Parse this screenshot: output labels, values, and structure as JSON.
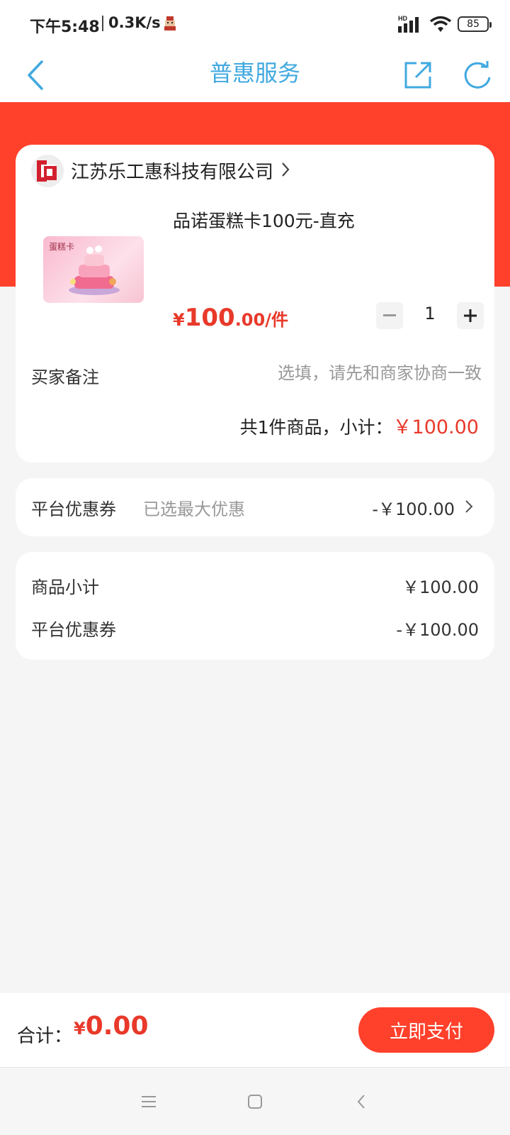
{
  "status_bar": {
    "time": "下午5:48",
    "net_speed": "0.3K/s",
    "signal_label": "HD",
    "battery": "85"
  },
  "nav": {
    "title": "普惠服务"
  },
  "shop": {
    "name": "江苏乐工惠科技有限公司"
  },
  "product": {
    "image_label": "蛋糕卡",
    "title": "品诺蛋糕卡100元-直充",
    "price_currency": "¥",
    "price_int": "100",
    "price_dec": ".00",
    "price_unit": "/件",
    "quantity": "1"
  },
  "note": {
    "label": "买家备注",
    "placeholder": "选填，请先和商家协商一致"
  },
  "order_subtotal": {
    "label": "共1件商品，小计：",
    "amount": "￥100.00"
  },
  "coupon": {
    "label": "平台优惠券",
    "hint": "已选最大优惠",
    "value": "-￥100.00"
  },
  "summary": {
    "rows": [
      {
        "label": "商品小计",
        "value": "￥100.00"
      },
      {
        "label": "平台优惠券",
        "value": "-￥100.00"
      }
    ]
  },
  "checkout": {
    "total_label": "合计：",
    "total_currency": "¥",
    "total_amount": "0.00",
    "pay_label": "立即支付"
  },
  "colors": {
    "accent_red": "#ff402b",
    "price_red": "#e8392a",
    "nav_blue": "#41a9e0",
    "background": "#f5f5f5"
  },
  "icons": [
    "back-icon",
    "share-icon",
    "refresh-icon",
    "shop-logo-icon",
    "chevron-right-icon",
    "menu-icon",
    "home-icon",
    "system-back-icon"
  ]
}
